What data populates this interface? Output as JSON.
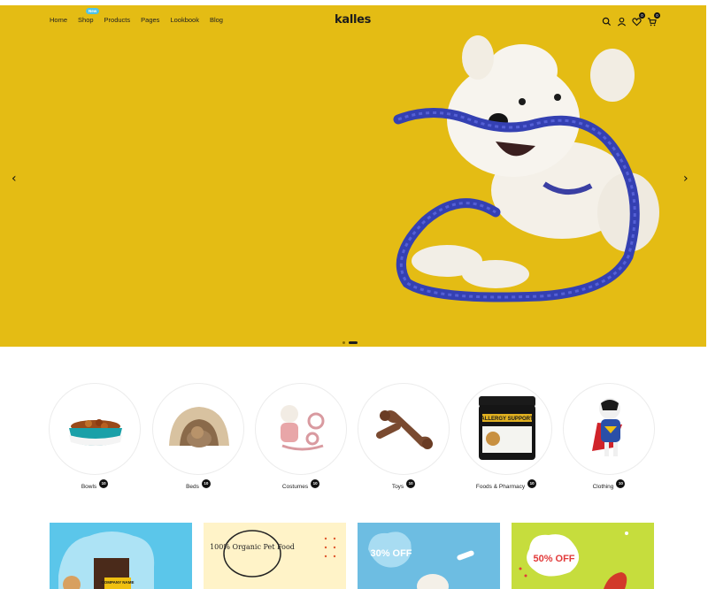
{
  "header": {
    "logo": "kalles",
    "menu": [
      {
        "label": "Home"
      },
      {
        "label": "Shop",
        "badge": "New"
      },
      {
        "label": "Products"
      },
      {
        "label": "Pages"
      },
      {
        "label": "Lookbook"
      },
      {
        "label": "Blog"
      }
    ],
    "icons": [
      "search-icon",
      "account-icon",
      "wishlist-icon",
      "cart-icon"
    ],
    "wishlist_count": "0",
    "cart_count": "0"
  },
  "hero": {
    "bg_color": "#e4bc14",
    "prev_arrow": "‹",
    "next_arrow": "›",
    "slides": 2,
    "active_slide": 2
  },
  "categories": [
    {
      "label": "Bowls",
      "count": "10"
    },
    {
      "label": "Beds",
      "count": "10"
    },
    {
      "label": "Costumes",
      "count": "10"
    },
    {
      "label": "Toys",
      "count": "10"
    },
    {
      "label": "Foods & Pharmacy",
      "count": "10"
    },
    {
      "label": "Clothing",
      "count": "10"
    }
  ],
  "banners": [
    {
      "text": "COMPANY NAME",
      "bg": "#5bc6ea"
    },
    {
      "text": "100% Organic Pet Food",
      "bg": "#fff3c8"
    },
    {
      "text": "30% OFF",
      "bg": "#6dbde2"
    },
    {
      "text": "50% OFF",
      "bg": "#c6dd3d"
    }
  ],
  "product_label": "ALLERGY SUPPORT"
}
